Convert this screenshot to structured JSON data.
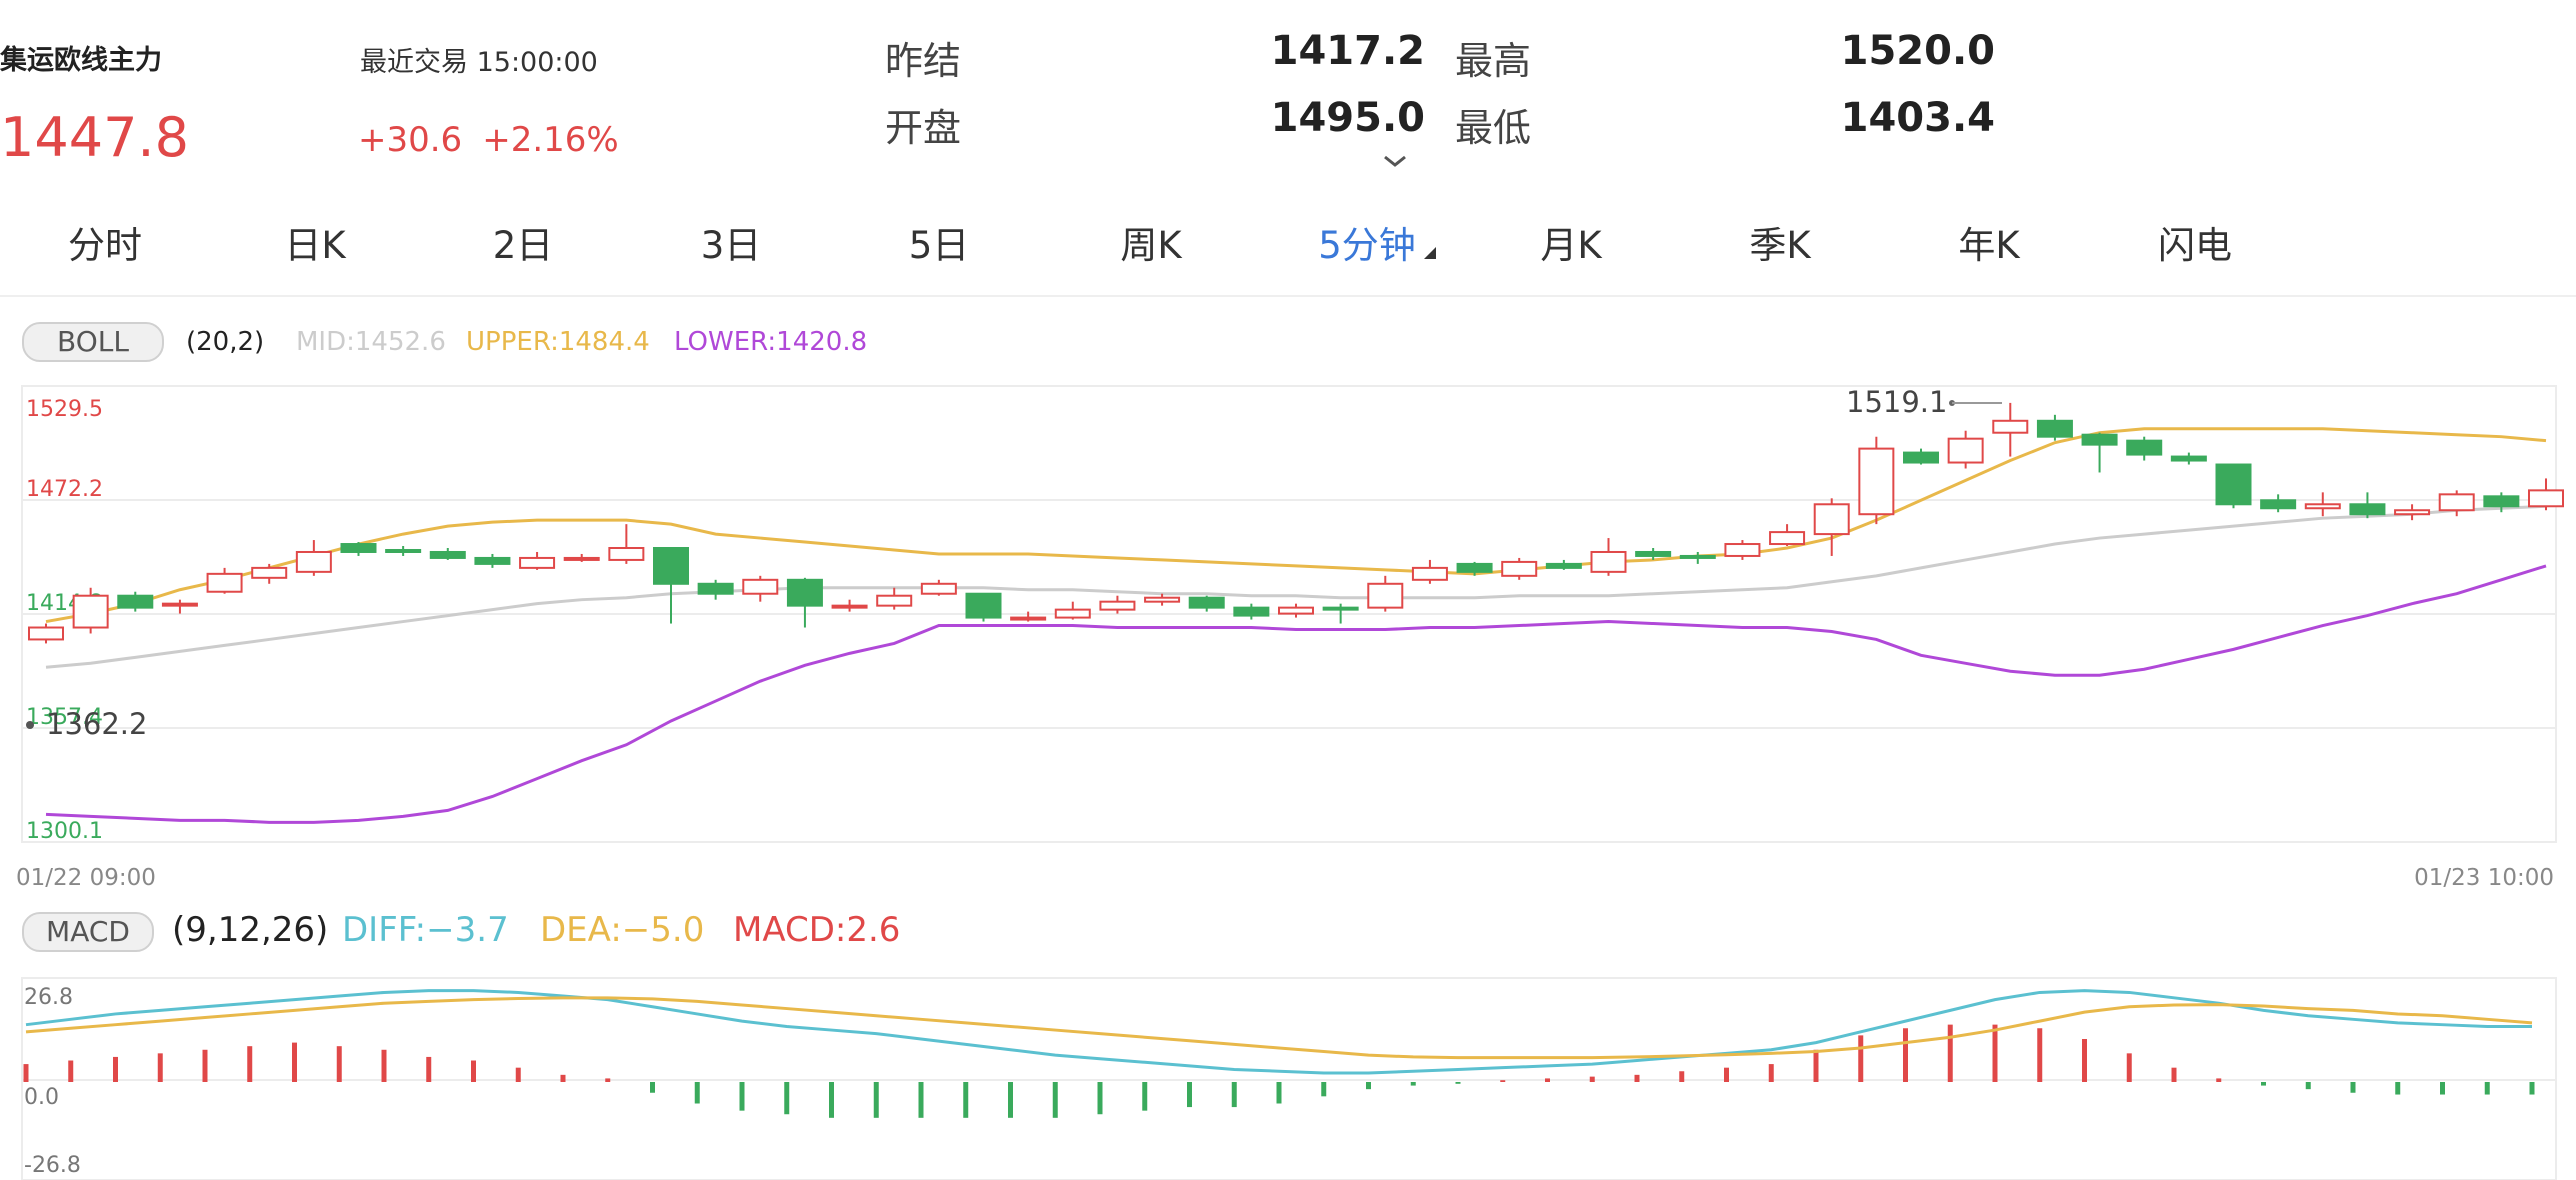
{
  "header": {
    "name": "集运欧线主力",
    "price": "1447.8",
    "last_trade_label": "最近交易 15:00:00",
    "change": "+30.6",
    "change_pct": "+2.16%",
    "stats": [
      {
        "label": "昨结",
        "value": "1417.2"
      },
      {
        "label": "最高",
        "value": "1520.0"
      },
      {
        "label": "开盘",
        "value": "1495.0"
      },
      {
        "label": "最低",
        "value": "1403.4"
      }
    ],
    "colors": {
      "up": "#e04848",
      "down": "#3aaa5c",
      "accent": "#3a78d8"
    }
  },
  "tabs": [
    {
      "label": "分时"
    },
    {
      "label": "日K"
    },
    {
      "label": "2日"
    },
    {
      "label": "3日"
    },
    {
      "label": "5日"
    },
    {
      "label": "周K"
    },
    {
      "label": "5分钟",
      "active": true
    },
    {
      "label": "月K"
    },
    {
      "label": "季K"
    },
    {
      "label": "年K"
    },
    {
      "label": "闪电"
    }
  ],
  "boll": {
    "button": "BOLL",
    "params": "(20,2)",
    "mid": "MID:1452.6",
    "upper": "UPPER:1484.4",
    "lower": "LOWER:1420.8",
    "colors": {
      "mid": "#cccccc",
      "upper": "#e8b84a",
      "lower": "#b048d8"
    }
  },
  "macd": {
    "button": "MACD",
    "params": "(9,12,26)",
    "diff": "DIFF:−3.7",
    "dea": "DEA:−5.0",
    "macd": "MACD:2.6",
    "colors": {
      "diff": "#5bc0d0",
      "dea": "#e8b84a",
      "macd": "#e04848"
    }
  },
  "chart_data": [
    {
      "type": "candlestick",
      "name": "5分钟 K线 + BOLL",
      "y_ticks": [
        "1529.5",
        "1472.2",
        "1414.8",
        "1357.4",
        "1300.1"
      ],
      "ylim": [
        1300.1,
        1529.5
      ],
      "x_labels": [
        "01/22 09:00",
        "01/23 10:00"
      ],
      "max_marker": "1519.1",
      "min_marker": "1362.2",
      "candles": [
        [
          1402,
          1408,
          1400,
          1410
        ],
        [
          1408,
          1424,
          1405,
          1428
        ],
        [
          1424,
          1418,
          1416,
          1426
        ],
        [
          1419,
          1420,
          1415,
          1422
        ],
        [
          1426,
          1435,
          1425,
          1438
        ],
        [
          1433,
          1438,
          1430,
          1440
        ],
        [
          1436,
          1446,
          1434,
          1452
        ],
        [
          1450,
          1446,
          1444,
          1451
        ],
        [
          1447,
          1446,
          1444,
          1449
        ],
        [
          1446,
          1443,
          1442,
          1448
        ],
        [
          1443,
          1440,
          1438,
          1445
        ],
        [
          1438,
          1443,
          1437,
          1446
        ],
        [
          1442,
          1443,
          1441,
          1445
        ],
        [
          1442,
          1448,
          1440,
          1460
        ],
        [
          1448,
          1430,
          1410,
          1448
        ],
        [
          1430,
          1425,
          1422,
          1432
        ],
        [
          1425,
          1432,
          1421,
          1434
        ],
        [
          1432,
          1419,
          1408,
          1433
        ],
        [
          1419,
          1419,
          1416,
          1422
        ],
        [
          1419,
          1424,
          1417,
          1428
        ],
        [
          1425,
          1430,
          1424,
          1432
        ],
        [
          1425,
          1413,
          1411,
          1425
        ],
        [
          1413,
          1413,
          1411,
          1416
        ],
        [
          1413,
          1417,
          1412,
          1421
        ],
        [
          1417,
          1421,
          1415,
          1424
        ],
        [
          1421,
          1423,
          1419,
          1425
        ],
        [
          1423,
          1418,
          1416,
          1424
        ],
        [
          1418,
          1414,
          1412,
          1420
        ],
        [
          1415,
          1418,
          1413,
          1420
        ],
        [
          1418,
          1417,
          1410,
          1420
        ],
        [
          1418,
          1430,
          1416,
          1434
        ],
        [
          1432,
          1438,
          1430,
          1442
        ],
        [
          1440,
          1436,
          1434,
          1441
        ],
        [
          1434,
          1441,
          1432,
          1443
        ],
        [
          1440,
          1438,
          1437,
          1442
        ],
        [
          1436,
          1446,
          1434,
          1453
        ],
        [
          1446,
          1444,
          1442,
          1448
        ],
        [
          1444,
          1443,
          1440,
          1446
        ],
        [
          1444,
          1450,
          1442,
          1452
        ],
        [
          1450,
          1456,
          1449,
          1460
        ],
        [
          1455,
          1470,
          1444,
          1473
        ],
        [
          1465,
          1498,
          1460,
          1504
        ],
        [
          1496,
          1491,
          1490,
          1498
        ],
        [
          1491,
          1503,
          1488,
          1507
        ],
        [
          1506,
          1512,
          1494,
          1521
        ],
        [
          1512,
          1504,
          1502,
          1515
        ],
        [
          1505,
          1500,
          1486,
          1506
        ],
        [
          1502,
          1495,
          1492,
          1504
        ],
        [
          1494,
          1492,
          1490,
          1496
        ],
        [
          1490,
          1470,
          1468,
          1490
        ],
        [
          1472,
          1468,
          1466,
          1475
        ],
        [
          1468,
          1470,
          1464,
          1476
        ],
        [
          1470,
          1465,
          1463,
          1476
        ],
        [
          1465,
          1467,
          1462,
          1470
        ],
        [
          1467,
          1475,
          1464,
          1477
        ],
        [
          1474,
          1469,
          1466,
          1476
        ],
        [
          1469,
          1477,
          1467,
          1483
        ]
      ],
      "series": [
        {
          "name": "UPPER",
          "values": [
            1411,
            1415,
            1420,
            1427,
            1432,
            1438,
            1444,
            1450,
            1455,
            1459,
            1461,
            1462,
            1462,
            1462,
            1460,
            1455,
            1453,
            1451,
            1449,
            1447,
            1445,
            1445,
            1445,
            1444,
            1443,
            1442,
            1441,
            1440,
            1439,
            1438,
            1437,
            1436,
            1435,
            1437,
            1439,
            1441,
            1442,
            1444,
            1445,
            1448,
            1453,
            1462,
            1472,
            1482,
            1492,
            1501,
            1506,
            1508,
            1508,
            1508,
            1508,
            1508,
            1507,
            1506,
            1505,
            1504,
            1502
          ]
        },
        {
          "name": "MID",
          "values": [
            1388,
            1390,
            1393,
            1396,
            1399,
            1402,
            1405,
            1408,
            1411,
            1414,
            1417,
            1420,
            1422,
            1423,
            1425,
            1426,
            1427,
            1428,
            1428,
            1428,
            1428,
            1428,
            1427,
            1427,
            1426,
            1425,
            1425,
            1424,
            1424,
            1423,
            1423,
            1423,
            1423,
            1424,
            1424,
            1424,
            1425,
            1426,
            1427,
            1428,
            1431,
            1434,
            1438,
            1442,
            1446,
            1450,
            1453,
            1455,
            1457,
            1459,
            1461,
            1463,
            1464,
            1465,
            1467,
            1468,
            1469
          ]
        },
        {
          "name": "LOWER",
          "values": [
            1314,
            1313,
            1312,
            1311,
            1311,
            1310,
            1310,
            1311,
            1313,
            1316,
            1323,
            1332,
            1341,
            1349,
            1361,
            1371,
            1381,
            1389,
            1395,
            1400,
            1409,
            1409,
            1409,
            1409,
            1408,
            1408,
            1408,
            1408,
            1407,
            1407,
            1407,
            1408,
            1408,
            1409,
            1410,
            1411,
            1410,
            1409,
            1408,
            1408,
            1406,
            1402,
            1394,
            1390,
            1386,
            1384,
            1384,
            1387,
            1392,
            1397,
            1403,
            1409,
            1414,
            1420,
            1425,
            1432,
            1439
          ]
        }
      ]
    },
    {
      "type": "macd",
      "y_ticks": [
        "26.8",
        "0.0",
        "-26.8"
      ],
      "ylim": [
        -26.8,
        26.8
      ],
      "series": [
        {
          "name": "DIFF",
          "values": [
            16,
            17.5,
            19,
            20,
            21,
            22,
            23,
            24,
            25,
            25.5,
            25.5,
            25,
            24,
            23,
            21,
            19,
            17,
            15.5,
            14.5,
            13.5,
            12,
            10.5,
            9,
            7.5,
            6.5,
            5.5,
            4.5,
            3.5,
            3,
            2.5,
            2.5,
            3,
            3.5,
            4,
            4.5,
            5,
            6,
            7,
            8,
            9,
            11,
            14,
            17,
            20,
            23,
            25,
            25.5,
            25,
            23.5,
            22,
            20,
            18.5,
            17.5,
            16.5,
            16,
            15.5,
            15.5
          ]
        },
        {
          "name": "DEA",
          "values": [
            14,
            15,
            16,
            17,
            18,
            19,
            20,
            21,
            22,
            22.5,
            23,
            23.3,
            23.5,
            23.5,
            23.2,
            22.5,
            21.5,
            20.5,
            19.5,
            18.5,
            17.5,
            16.5,
            15.5,
            14.5,
            13.5,
            12.5,
            11.5,
            10.5,
            9.5,
            8.5,
            7.5,
            7,
            6.8,
            6.8,
            6.8,
            6.8,
            7,
            7.3,
            7.6,
            8,
            8.5,
            9.5,
            11,
            12.5,
            14.5,
            17,
            19.5,
            21,
            21.5,
            21.6,
            21.2,
            20.5,
            20,
            19,
            18.5,
            17.5,
            16.5
          ]
        },
        {
          "name": "MACD",
          "values": [
            5,
            6,
            7,
            8,
            9,
            10,
            11,
            10,
            9,
            7,
            6,
            4,
            2,
            1,
            -3,
            -6,
            -8,
            -9,
            -10,
            -10,
            -10,
            -10,
            -10,
            -10,
            -9,
            -8,
            -7,
            -7,
            -6,
            -4,
            -2,
            -1,
            -0.5,
            0.5,
            1,
            1.5,
            2,
            3,
            4,
            5,
            9,
            13,
            15,
            16,
            16,
            15,
            12,
            8,
            4,
            1,
            -1,
            -2,
            -3,
            -3.5,
            -3.5,
            -3.5,
            -3.5
          ]
        }
      ]
    }
  ]
}
